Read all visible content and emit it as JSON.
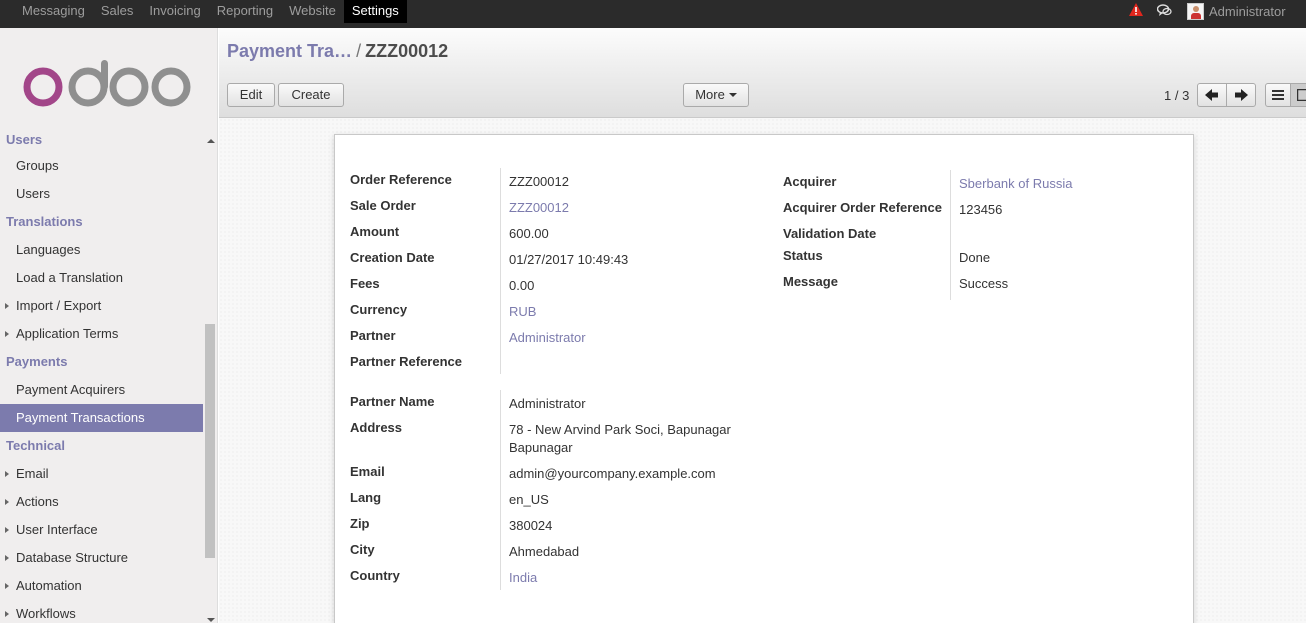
{
  "topbar": {
    "menu": [
      "Messaging",
      "Sales",
      "Invoicing",
      "Reporting",
      "Website",
      "Settings"
    ],
    "active": "Settings",
    "user": "Administrator",
    "icons": [
      "alert-icon",
      "chat-icon",
      "avatar"
    ]
  },
  "sidebar": {
    "logo": "odoo",
    "sections": [
      {
        "title": "Users",
        "items": [
          {
            "label": "Groups"
          },
          {
            "label": "Users"
          }
        ]
      },
      {
        "title": "Translations",
        "items": [
          {
            "label": "Languages"
          },
          {
            "label": "Load a Translation"
          },
          {
            "label": "Import / Export",
            "expandable": true
          },
          {
            "label": "Application Terms",
            "expandable": true
          }
        ]
      },
      {
        "title": "Payments",
        "items": [
          {
            "label": "Payment Acquirers"
          },
          {
            "label": "Payment Transactions",
            "active": true
          }
        ]
      },
      {
        "title": "Technical",
        "items": [
          {
            "label": "Email",
            "expandable": true
          },
          {
            "label": "Actions",
            "expandable": true
          },
          {
            "label": "User Interface",
            "expandable": true
          },
          {
            "label": "Database Structure",
            "expandable": true
          },
          {
            "label": "Automation",
            "expandable": true
          },
          {
            "label": "Workflows",
            "expandable": true
          }
        ]
      }
    ]
  },
  "control_panel": {
    "breadcrumb_parent": "Payment Tra…",
    "breadcrumb_sep": "/",
    "breadcrumb_current": "ZZZ00012",
    "edit_label": "Edit",
    "create_label": "Create",
    "more_label": "More",
    "pager": "1 / 3"
  },
  "form": {
    "left_group": [
      {
        "label": "Order Reference",
        "value": "ZZZ00012",
        "link": false
      },
      {
        "label": "Sale Order",
        "value": "ZZZ00012",
        "link": true
      },
      {
        "label": "Amount",
        "value": "600.00",
        "link": false
      },
      {
        "label": "Creation Date",
        "value": "01/27/2017 10:49:43",
        "link": false
      },
      {
        "label": "Fees",
        "value": "0.00",
        "link": false
      },
      {
        "label": "Currency",
        "value": "RUB",
        "link": true
      },
      {
        "label": "Partner",
        "value": "Administrator",
        "link": true
      },
      {
        "label": "Partner Reference",
        "value": "",
        "link": false
      }
    ],
    "right_group": [
      {
        "label": "Acquirer",
        "value": "Sberbank of Russia",
        "link": true
      },
      {
        "label": "Acquirer Order Reference",
        "value": "123456",
        "link": false
      },
      {
        "label": "Validation Date",
        "value": "",
        "link": false
      },
      {
        "label": "Status",
        "value": "Done",
        "link": false
      },
      {
        "label": "Message",
        "value": "Success",
        "link": false
      }
    ],
    "partner_group": [
      {
        "label": "Partner Name",
        "value": "Administrator",
        "link": false
      },
      {
        "label": "Address",
        "value": "78 - New Arvind Park Soci, Bapunagar",
        "value2": "Bapunagar",
        "link": false
      },
      {
        "label": "Email",
        "value": "admin@yourcompany.example.com",
        "link": false
      },
      {
        "label": "Lang",
        "value": "en_US",
        "link": false
      },
      {
        "label": "Zip",
        "value": "380024",
        "link": false
      },
      {
        "label": "City",
        "value": "Ahmedabad",
        "link": false
      },
      {
        "label": "Country",
        "value": "India",
        "link": true
      }
    ]
  },
  "colors": {
    "accent": "#7c7bad",
    "topbar": "#2b2b2b",
    "sidebar": "#f0eeee"
  }
}
